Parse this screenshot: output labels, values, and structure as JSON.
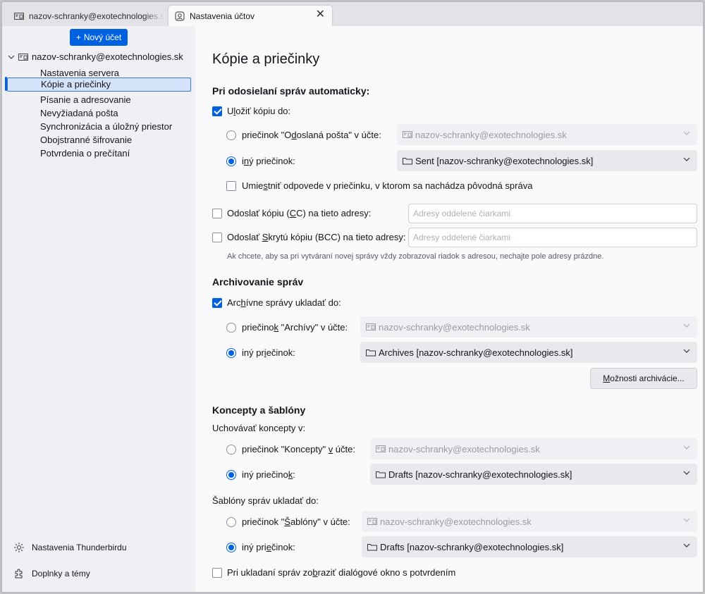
{
  "tabs": [
    {
      "label": "nazov-schranky@exotechnologies.sk",
      "active": false
    },
    {
      "label": "Nastavenia účtov",
      "active": true
    }
  ],
  "sidebar": {
    "new_account_label": "Nový účet",
    "account": "nazov-schranky@exotechnologies.sk",
    "items": [
      "Nastavenia servera",
      "Kópie a priečinky",
      "Písanie a adresovanie",
      "Nevyžiadaná pošta",
      "Synchronizácia a úložný priestor",
      "Obojstranné šifrovanie",
      "Potvrdenia o prečítaní"
    ],
    "selected_index": 1,
    "footer": [
      "Nastavenia Thunderbirdu",
      "Doplnky a témy"
    ]
  },
  "main": {
    "title": "Kópie a priečinky",
    "send": {
      "heading": "Pri odosielaní správ automaticky:",
      "save_copy": {
        "pre": "U",
        "u": "l",
        "post": "ožiť kópiu do:",
        "checked": true
      },
      "radio_sent": {
        "pre": "priečinok \"O",
        "u": "d",
        "post": "oslaná pošta\" v účte:",
        "checked": false
      },
      "radio_sent_value": "nazov-schranky@exotechnologies.sk",
      "radio_other": {
        "pre": "i",
        "u": "n",
        "post": "ý priečinok:",
        "checked": true
      },
      "radio_other_value": "Sent [nazov-schranky@exotechnologies.sk]",
      "replies_in_folder": {
        "pre": "Umie",
        "u": "s",
        "post": "tniť odpovede v priečinku, v ktorom sa nachádza pôvodná správa",
        "checked": false
      },
      "cc": {
        "pre": "Odoslať kópiu (",
        "u": "C",
        "post": "C) na tieto adresy:",
        "checked": false,
        "placeholder": "Adresy oddelené čiarkami"
      },
      "bcc": {
        "pre": "Odoslať ",
        "u": "S",
        "post": "krytú kópiu (BCC) na tieto adresy:",
        "checked": false,
        "placeholder": "Adresy oddelené čiarkami"
      },
      "hint": "Ak chcete, aby sa pri vytváraní novej správy vždy zobrazoval riadok s adresou, nechajte pole adresy prázdne."
    },
    "archive": {
      "heading": "Archivovanie správ",
      "keep": {
        "pre": "Arc",
        "u": "h",
        "post": "ívne správy ukladať do:",
        "checked": true
      },
      "radio_archives": {
        "pre": "priečino",
        "u": "k",
        "post": " \"Archívy\" v účte:",
        "checked": false
      },
      "radio_archives_value": "nazov-schranky@exotechnologies.sk",
      "radio_other": {
        "pre": "iný pr",
        "u": "i",
        "post": "ečinok:",
        "checked": true
      },
      "radio_other_value": "Archives [nazov-schranky@exotechnologies.sk]",
      "options_button": {
        "pre": "",
        "u": "M",
        "post": "ožnosti archivácie..."
      }
    },
    "drafts": {
      "heading": "Koncepty a šablóny",
      "keep_label": "Uchovávať koncepty v:",
      "radio_drafts": {
        "pre": "priečinok \"Koncepty\" ",
        "u": "v",
        "post": " účte:",
        "checked": false
      },
      "radio_drafts_value": "nazov-schranky@exotechnologies.sk",
      "radio_other": {
        "pre": "iný priečino",
        "u": "k",
        "post": ":",
        "checked": true
      },
      "radio_other_value": "Drafts [nazov-schranky@exotechnologies.sk]",
      "templates_label": "Šablóny správ ukladať do:",
      "radio_templates": {
        "pre": "priečinok \"",
        "u": "Š",
        "post": "ablóny\" v účte:",
        "checked": false
      },
      "radio_templates_value": "nazov-schranky@exotechnologies.sk",
      "radio_templates_other": {
        "pre": "iný pri",
        "u": "e",
        "post": "činok:",
        "checked": true
      },
      "radio_templates_other_value": "Drafts [nazov-schranky@exotechnologies.sk]",
      "confirm": {
        "pre": "Pri ukladaní správ zo",
        "u": "b",
        "post": "raziť dialógové okno s potvrdením",
        "checked": false
      }
    }
  },
  "colors": {
    "accent": "#0061e0",
    "sidebar_bg": "#f0f0f4",
    "main_bg": "#f9f9fb",
    "selected_bg": "#d4e3f9"
  }
}
